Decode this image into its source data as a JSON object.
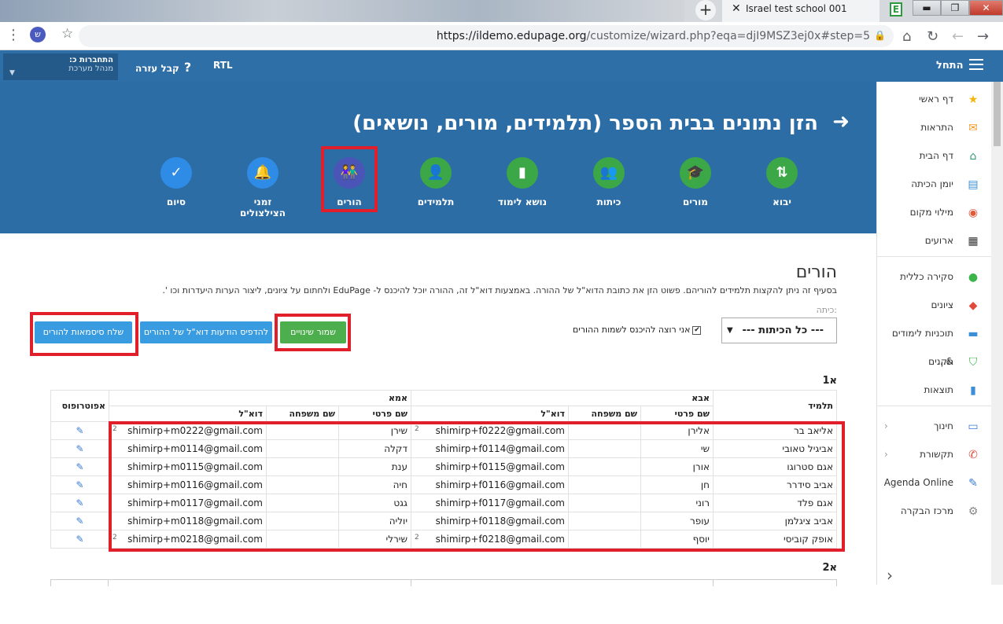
{
  "browser": {
    "tab_title": "Israel test school 001",
    "new_tab": "+",
    "url_host": "https://ildemo.edupage.org",
    "url_rest": "/customize/wizard.php?eqa=djI9MSZ3ej0x#step=5",
    "profile_letter": "ש"
  },
  "header": {
    "account_title": "התחברות כ:",
    "account_role": "מנהל מערכת",
    "help": "קבל עזרה",
    "rtl": "RTL",
    "start": "התחל"
  },
  "hero": {
    "title": "הזן נתונים בבית הספר (תלמידים, מורים, נושאים)",
    "steps": [
      {
        "label": "יבוא",
        "icon": "⇅",
        "color": "green"
      },
      {
        "label": "מורים",
        "icon": "🎓",
        "color": "green"
      },
      {
        "label": "כיתות",
        "icon": "👥",
        "color": "green"
      },
      {
        "label": "נושא לימוד",
        "icon": "▮",
        "color": "green"
      },
      {
        "label": "תלמידים",
        "icon": "👤",
        "color": "green"
      },
      {
        "label": "הורים",
        "icon": "👫",
        "color": "purple"
      },
      {
        "label": "זמני הצילצולים",
        "icon": "🔔",
        "color": "blue"
      },
      {
        "label": "סיום",
        "icon": "✓",
        "color": "blue"
      }
    ]
  },
  "sidebar": {
    "items": [
      {
        "label": "דף ראשי",
        "icon": "★",
        "color": "#f5b50a"
      },
      {
        "label": "התראות",
        "icon": "✉",
        "color": "#f59a23"
      },
      {
        "label": "דף הבית",
        "icon": "⌂",
        "color": "#2e9a7a"
      },
      {
        "label": "יומן הכיתה",
        "icon": "▤",
        "color": "#3a8fd6"
      },
      {
        "label": "מילוי מקום",
        "icon": "◉",
        "color": "#e05a3a"
      },
      {
        "label": "ארועים",
        "icon": "▦",
        "color": "#333333"
      },
      {
        "label": "סקירה כללית",
        "icon": "●",
        "color": "#3bb54a"
      },
      {
        "label": "ציונים",
        "icon": "◆",
        "color": "#e04a3a"
      },
      {
        "label": "תוכניות לימודים &...",
        "icon": "▬",
        "color": "#3a8fd6"
      },
      {
        "label": "תקנים",
        "icon": "⛉",
        "color": "#3bb54a"
      },
      {
        "label": "תוצאות",
        "icon": "▮",
        "color": "#3a8fd6"
      },
      {
        "label": "חינוך",
        "icon": "▭",
        "color": "#3a7bd5"
      },
      {
        "label": "תקשורת",
        "icon": "✆",
        "color": "#e04a3a"
      },
      {
        "label": "Agenda Online",
        "icon": "✎",
        "color": "#3a7bd5"
      },
      {
        "label": "מרכז הבקרה",
        "icon": "⚙",
        "color": "#888888"
      }
    ],
    "collapse": "‹"
  },
  "main": {
    "title": "הורים",
    "desc": "בסעיף זה ניתן להקצות תלמידים להוריהם. פשוט הזן את כתובת הדוא\"ל של ההורה. באמצעות דוא\"ל זה, ההורה יוכל להיכנס ל- EduPage ולחתום על ציונים, ליצור הערות היעדרות וכו '.",
    "class_label": "כיתה:",
    "class_select": "--- כל הכיתות ---",
    "checkbox_label": "אני רוצה להיכנס לשמות ההורים",
    "save_btn": "שמור שינויים",
    "print_btn": "להדפיס הודעות דוא\"ל של ההורים",
    "send_btn": "שלח סיסמאות להורים",
    "class1": "א1",
    "class2": "א2"
  },
  "table": {
    "h_student": "תלמיד",
    "h_father": "אבא",
    "h_mother": "אמא",
    "h_guardian": "אפוטרופוס",
    "h_first": "שם פרטי",
    "h_last": "שם משפחה",
    "h_email": "דוא\"ל",
    "rows": [
      {
        "student": "אליאב בר",
        "f_first": "אלירן",
        "f_last": "",
        "f_email": "shimirp+f0222@gmail.com",
        "f_n": "2",
        "m_first": "שירן",
        "m_last": "",
        "m_email": "shimirp+m0222@gmail.com",
        "m_n": "2"
      },
      {
        "student": "אביגיל טאובי",
        "f_first": "שי",
        "f_last": "",
        "f_email": "shimirp+f0114@gmail.com",
        "f_n": "",
        "m_first": "דקלה",
        "m_last": "",
        "m_email": "shimirp+m0114@gmail.com",
        "m_n": ""
      },
      {
        "student": "אגם סטרוגו",
        "f_first": "אורן",
        "f_last": "",
        "f_email": "shimirp+f0115@gmail.com",
        "f_n": "",
        "m_first": "ענת",
        "m_last": "",
        "m_email": "shimirp+m0115@gmail.com",
        "m_n": ""
      },
      {
        "student": "אביב סידרר",
        "f_first": "חן",
        "f_last": "",
        "f_email": "shimirp+f0116@gmail.com",
        "f_n": "",
        "m_first": "חיה",
        "m_last": "",
        "m_email": "shimirp+m0116@gmail.com",
        "m_n": ""
      },
      {
        "student": "אגם פלד",
        "f_first": "רוני",
        "f_last": "",
        "f_email": "shimirp+f0117@gmail.com",
        "f_n": "",
        "m_first": "גגט",
        "m_last": "",
        "m_email": "shimirp+m0117@gmail.com",
        "m_n": ""
      },
      {
        "student": "אביב ציגלמן",
        "f_first": "עופר",
        "f_last": "",
        "f_email": "shimirp+f0118@gmail.com",
        "f_n": "",
        "m_first": "יוליה",
        "m_last": "",
        "m_email": "shimirp+m0118@gmail.com",
        "m_n": ""
      },
      {
        "student": "אופק קוביסי",
        "f_first": "יוסף",
        "f_last": "",
        "f_email": "shimirp+f0218@gmail.com",
        "f_n": "2",
        "m_first": "שירלי",
        "m_last": "",
        "m_email": "shimirp+m0218@gmail.com",
        "m_n": "2"
      }
    ]
  }
}
